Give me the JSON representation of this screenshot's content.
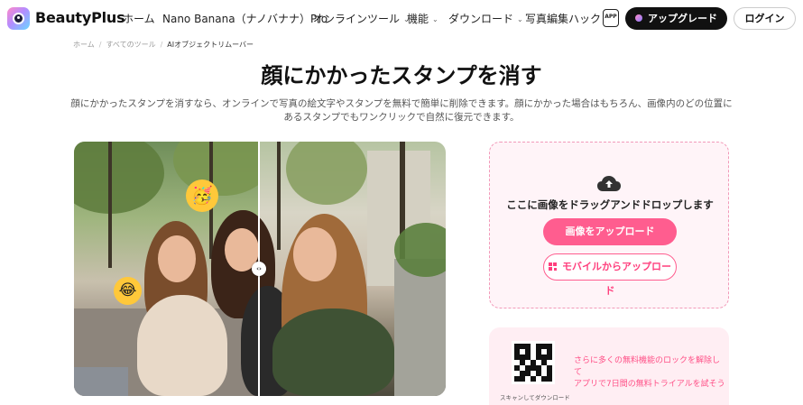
{
  "header": {
    "brand": "BeautyPlus",
    "nav": [
      {
        "label": "ホーム",
        "has_dropdown": false
      },
      {
        "label": "Nano Banana（ナノバナナ）Pro",
        "has_dropdown": false
      },
      {
        "label": "オンラインツール",
        "has_dropdown": true
      },
      {
        "label": "機能",
        "has_dropdown": true
      },
      {
        "label": "ダウンロード",
        "has_dropdown": true
      },
      {
        "label": "写真編集ハック",
        "has_dropdown": false
      }
    ],
    "app_icon_text": "APP",
    "upgrade_label": "アップグレード",
    "login_label": "ログイン"
  },
  "breadcrumb": {
    "items": [
      "ホーム",
      "すべてのツール",
      "AIオブジェクトリムーバー"
    ],
    "separator": "/"
  },
  "hero": {
    "title": "顔にかかったスタンプを消す",
    "description": "顔にかかったスタンプを消すなら、オンラインで写真の絵文字やスタンプを無料で簡単に削除できます。顔にかかった場合はもちろん、画像内のどの位置にあるスタンプでもワンクリックで自然に復元できます。"
  },
  "compare": {
    "handle_glyph": "‹›",
    "emoji_top": "🥳",
    "emoji_left": "😂"
  },
  "upload": {
    "drop_text": "ここに画像をドラッグアンドドロップします",
    "upload_button": "画像をアップロード",
    "mobile_button": "モバイルからアップロード"
  },
  "promo": {
    "qr_caption": "スキャンしてダウンロード",
    "line1": "さらに多くの無料機能のロックを解除し",
    "line2": "て",
    "line3": "アプリで7日間の無料トライアルを試そう"
  },
  "colors": {
    "accent_pink": "#ff5d8f",
    "upgrade_bg": "#111111",
    "upload_bg": "#fff4f8",
    "promo_bg": "#ffeef3"
  }
}
